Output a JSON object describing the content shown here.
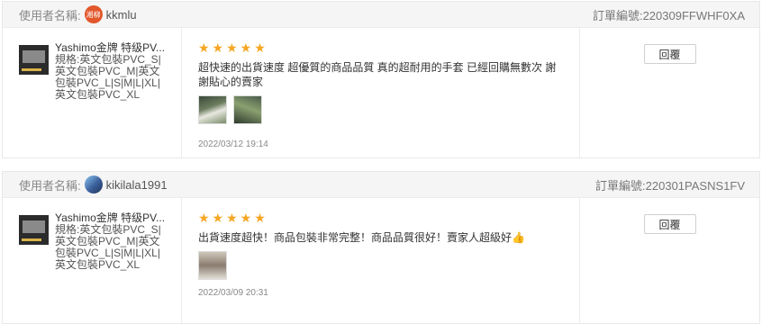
{
  "reviews": [
    {
      "user_label": "使用者名稱:",
      "avatar_text": "湘柳",
      "username": "kkmlu",
      "order_no": "訂單編號:220309FFWHF0XA",
      "product_title": "Yashimo金牌 特级PV...",
      "product_spec": "規格:英文包裝PVC_S|英文包裝PVC_M|英文包裝PVC_L|S|M|L|XL|英文包裝PVC_XL",
      "stars": "★★★★★",
      "comment": "超快速的出貨速度 超優質的商品品質 真的超耐用的手套 已經回購無數次 謝謝貼心的賣家",
      "emoji": "",
      "date": "2022/03/12 19:14",
      "reply_label": "回覆"
    },
    {
      "user_label": "使用者名稱:",
      "avatar_text": "",
      "username": "kikilala1991",
      "order_no": "訂單編號:220301PASNS1FV",
      "product_title": "Yashimo金牌 特级PV...",
      "product_spec": "規格:英文包裝PVC_S|英文包裝PVC_M|英文包裝PVC_L|S|M|L|XL|英文包裝PVC_XL",
      "stars": "★★★★★",
      "comment": "出貨速度超快！商品包裝非常完整！商品品質很好！賣家人超級好",
      "emoji": "👍",
      "date": "2022/03/09 20:31",
      "reply_label": "回覆"
    }
  ],
  "colors": {
    "star": "#f5a623",
    "avatar1": "#e2572b"
  }
}
